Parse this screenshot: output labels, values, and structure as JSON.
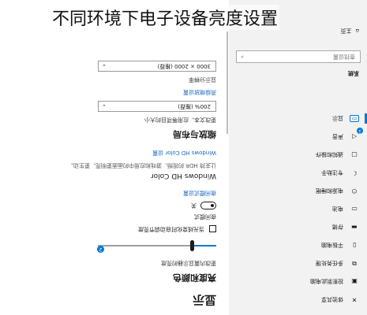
{
  "overlay": {
    "title": "不同环境下电子设备亮度设置"
  },
  "main": {
    "page_title": "显示",
    "brightness_section": "亮度和颜色",
    "brightness_label": "更改内置显示器的亮度",
    "brightness_value": 0.2,
    "slider_badge": "2",
    "auto_brightness_label": "当光线变化时自动调节亮度",
    "night_light_label": "夜间模式",
    "night_light_state": "关",
    "night_light_link": "夜间模式设置",
    "hdr_title": "Windows HD Color",
    "hdr_hint": "让支持 HDR 的视频、游戏和应用中的画面更明亮、更生动。",
    "hdr_link": "Windows HD Color 设置",
    "scale_section": "缩放与布局",
    "scale_label": "更改文本、应用等项目的大小",
    "scale_value": "200% (推荐)",
    "advanced_scale_link": "高级缩放设置",
    "resolution_label": "显示分辨率",
    "resolution_value": "3000 × 2000 (推荐)"
  },
  "nav": {
    "home": "主页",
    "search_placeholder": "查找设置",
    "group": "系统",
    "badge": "1",
    "items": [
      {
        "icon": "display-icon",
        "glyph": "▭",
        "label": "显示",
        "active": true
      },
      {
        "icon": "sound-icon",
        "glyph": "◁",
        "label": "声音"
      },
      {
        "icon": "notifications-icon",
        "glyph": "▢",
        "label": "通知和操作"
      },
      {
        "icon": "focus-assist-icon",
        "glyph": "☾",
        "label": "专注助手"
      },
      {
        "icon": "power-sleep-icon",
        "glyph": "⏻",
        "label": "电源和睡眠"
      },
      {
        "icon": "battery-icon",
        "glyph": "▭",
        "label": "电池"
      },
      {
        "icon": "storage-icon",
        "glyph": "▬",
        "label": "存储"
      },
      {
        "icon": "tablet-icon",
        "glyph": "▯",
        "label": "平板电脑"
      },
      {
        "icon": "multitasking-icon",
        "glyph": "⧉",
        "label": "多任务处理"
      },
      {
        "icon": "projecting-icon",
        "glyph": "▣",
        "label": "投影到此电脑"
      },
      {
        "icon": "shared-experiences-icon",
        "glyph": "✕",
        "label": "体验共享"
      }
    ]
  }
}
